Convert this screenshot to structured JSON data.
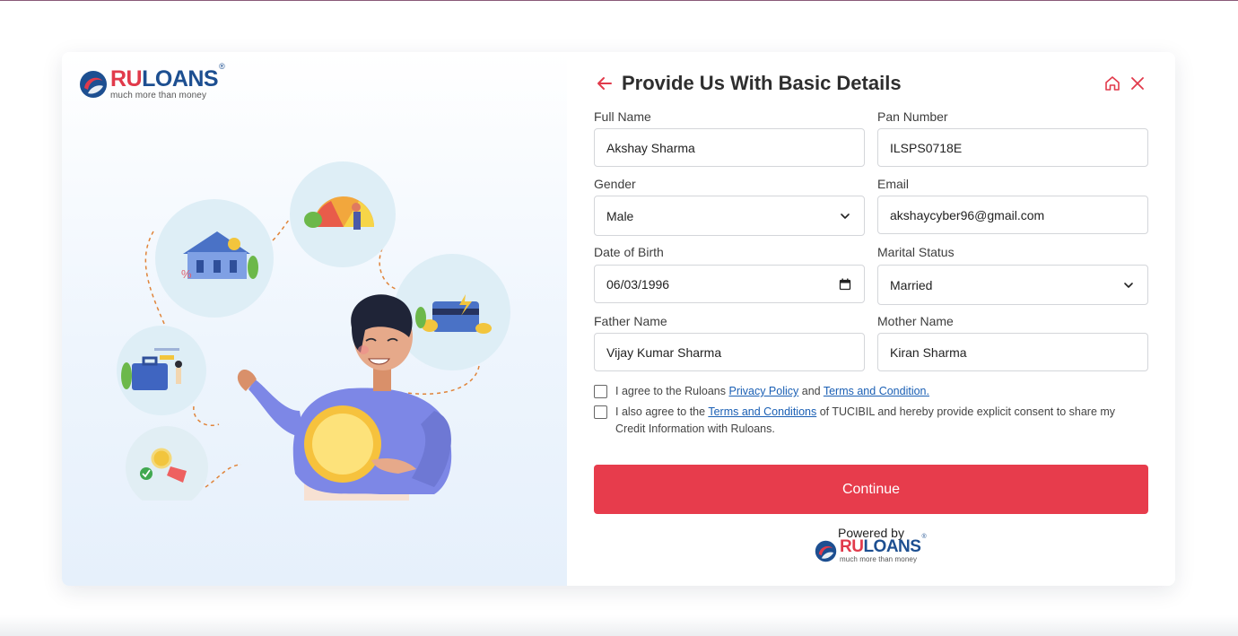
{
  "brand": {
    "name_part1": "RU",
    "name_part2": "LOANS",
    "registered_mark": "®",
    "tagline": "much more than money",
    "primary_color": "#e13a4b",
    "secondary_color": "#1d4f91"
  },
  "header": {
    "title": "Provide Us With Basic Details",
    "back_icon": "arrow-left-icon",
    "home_icon": "home-icon",
    "close_icon": "close-icon"
  },
  "form": {
    "full_name": {
      "label": "Full Name",
      "value": "Akshay Sharma"
    },
    "pan_number": {
      "label": "Pan Number",
      "value": "ILSPS0718E"
    },
    "gender": {
      "label": "Gender",
      "value": "Male"
    },
    "email": {
      "label": "Email",
      "value": "akshaycyber96@gmail.com"
    },
    "date_of_birth": {
      "label": "Date of Birth",
      "value": "06/03/1996"
    },
    "marital_status": {
      "label": "Marital Status",
      "value": "Married"
    },
    "father_name": {
      "label": "Father Name",
      "value": "Vijay Kumar Sharma"
    },
    "mother_name": {
      "label": "Mother Name",
      "value": "Kiran Sharma"
    }
  },
  "consents": {
    "first": {
      "prefix": "I agree to the Ruloans ",
      "link1": "Privacy Policy",
      "middle": " and ",
      "link2": "Terms and Condition."
    },
    "second": {
      "prefix": "I also agree to the ",
      "link": "Terms and Conditions",
      "suffix": " of TUCIBIL and hereby provide explicit consent to share my Credit Information with Ruloans."
    }
  },
  "continue_label": "Continue",
  "powered_by": "Powered by",
  "accent_color": "#e73c4c"
}
